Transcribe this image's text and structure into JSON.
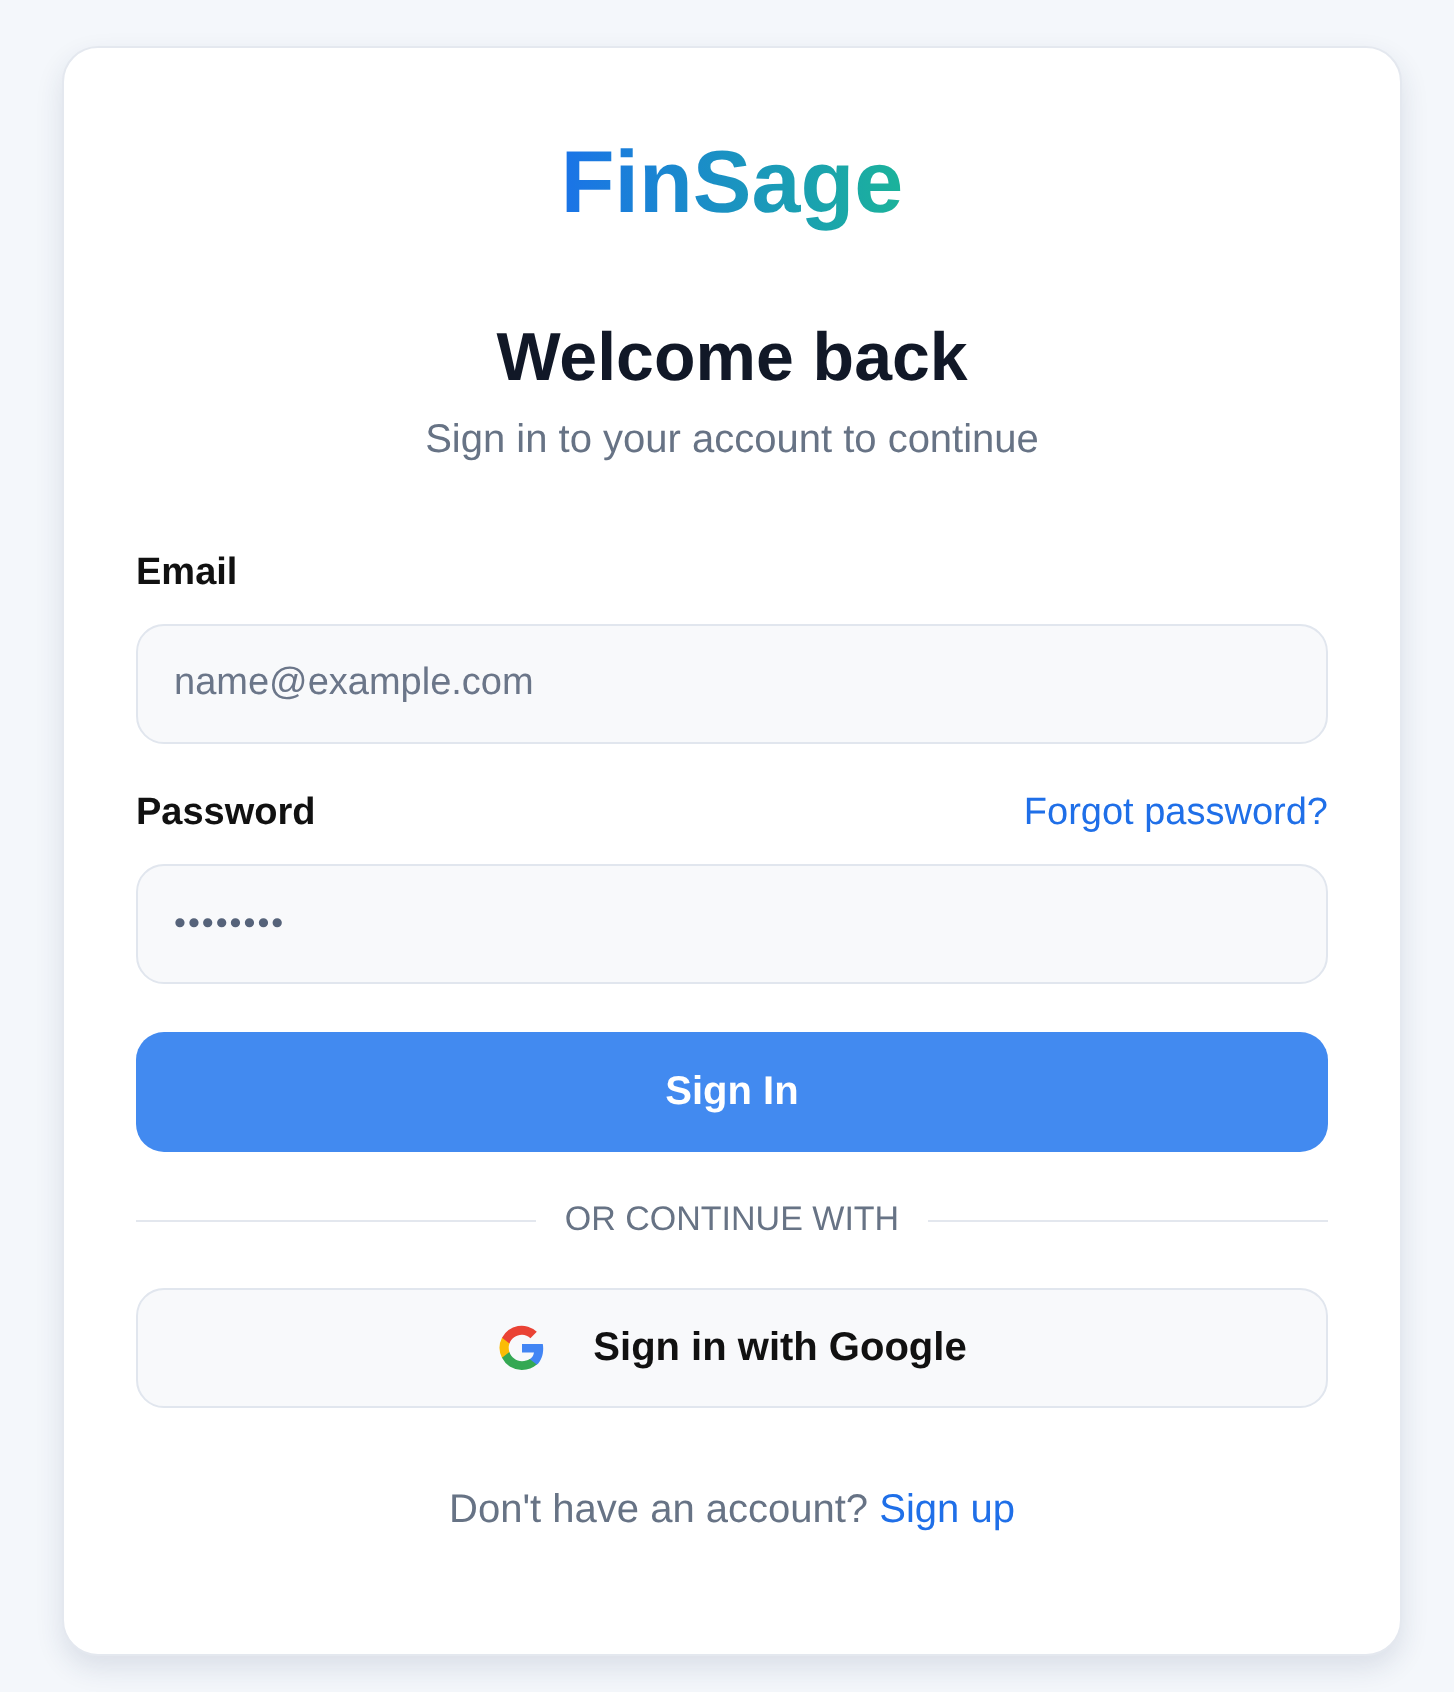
{
  "logo": "FinSage",
  "heading": "Welcome back",
  "subheading": "Sign in to your account to continue",
  "fields": [
    {
      "label": "Email",
      "placeholder": "name@example.com"
    },
    {
      "label": "Password",
      "value": "••••••••",
      "link": "Forgot password?"
    }
  ],
  "submit_button": "Sign In",
  "divider": "OR CONTINUE WITH",
  "google_button": "Sign in with Google",
  "footer": {
    "text": "Don't have an account?",
    "link": "Sign up"
  }
}
